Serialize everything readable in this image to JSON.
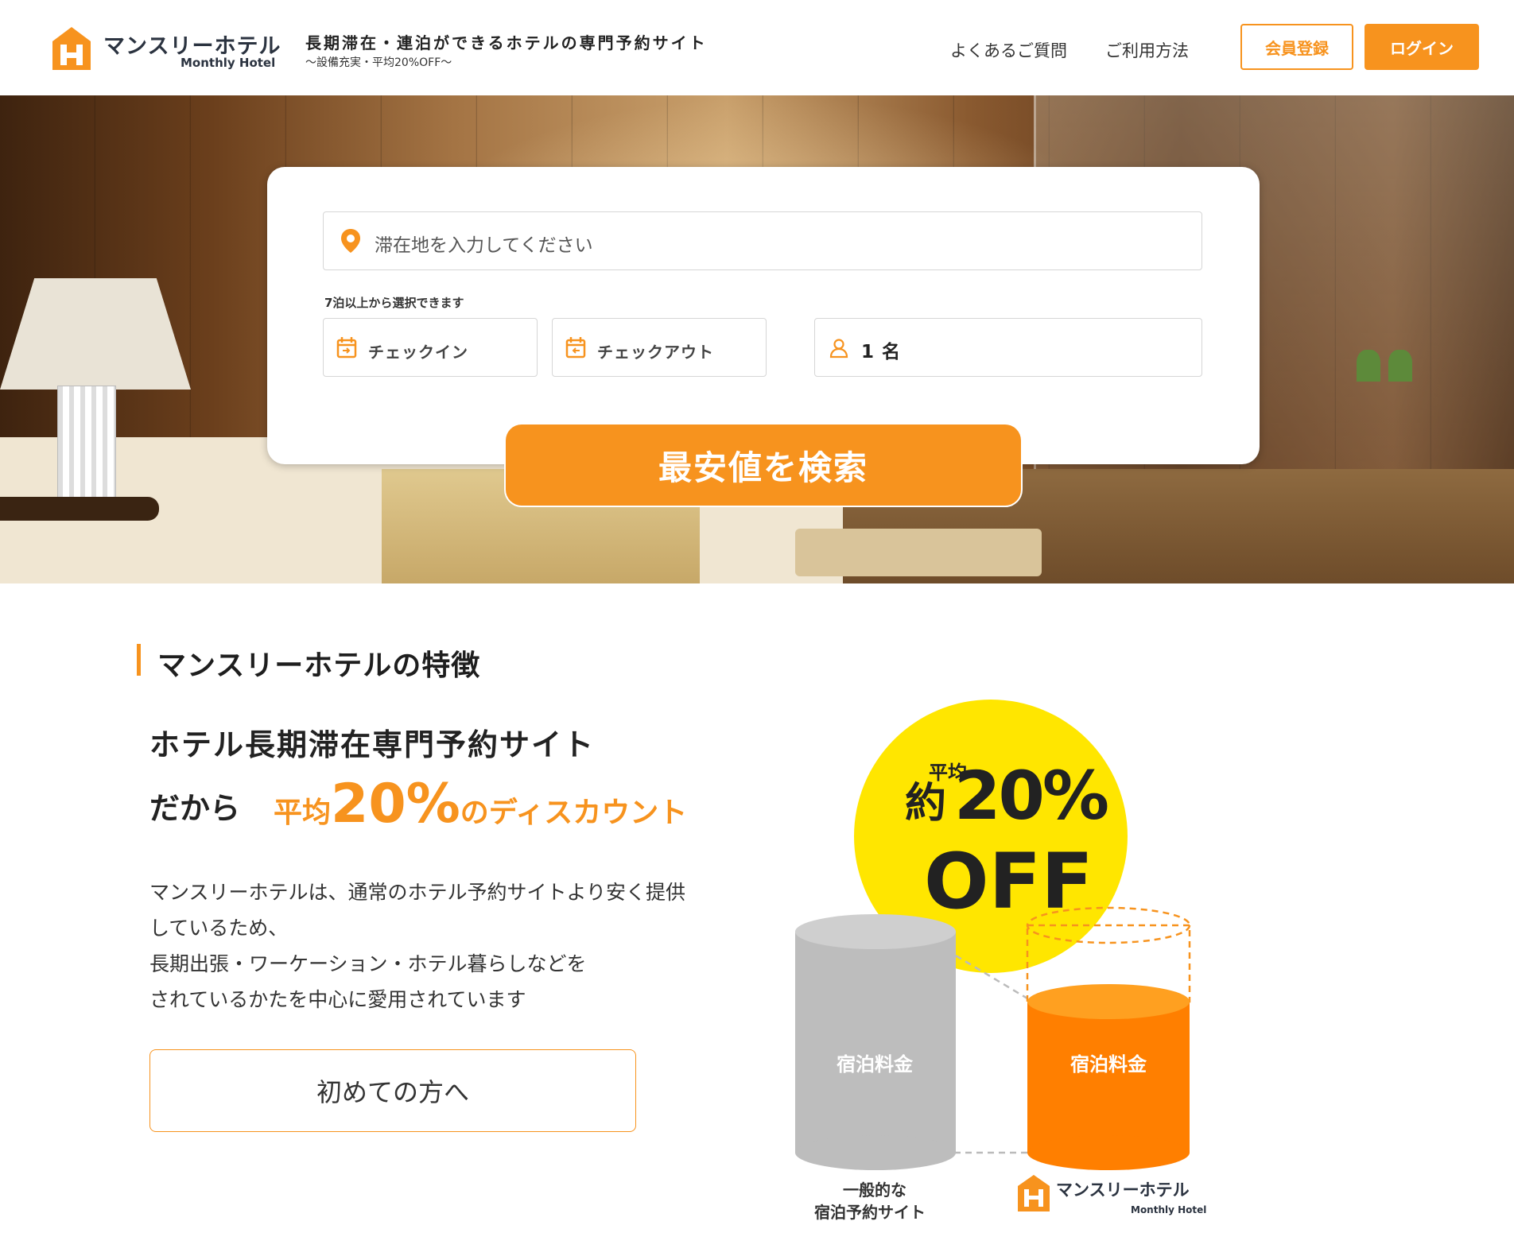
{
  "header": {
    "logo_jp": "マンスリーホテル",
    "logo_en": "Monthly Hotel",
    "tagline": "長期滞在・連泊ができるホテルの専門予約サイト",
    "subtagline": "〜設備充実・平均20%OFF〜",
    "nav": {
      "faq": "よくあるご質問",
      "howto": "ご利用方法"
    },
    "register_label": "会員登録",
    "login_label": "ログイン"
  },
  "search": {
    "location_placeholder": "滞在地を入力してください",
    "note": "7泊以上から選択できます",
    "checkin_label": "チェックイン",
    "checkout_label": "チェックアウト",
    "guests_label": "1 名",
    "submit_label": "最安値を検索"
  },
  "features": {
    "section_title": "マンスリーホテルの特徴",
    "headline_line1": "ホテル長期滞在専門予約サイト",
    "headline_line2_prefix": "だから",
    "headline_avg": "平均",
    "headline_percent": "20%",
    "headline_suffix": "のディスカウント",
    "body_lines": [
      "マンスリーホテルは、通常のホテル予約サイトより安く提供",
      "しているため、",
      "長期出張・ワーケーション・ホテル暮らしなどを",
      "されているかたを中心に愛用されています"
    ],
    "first_time_label": "初めての方へ"
  },
  "illustration": {
    "badge_avg": "平均",
    "badge_approx": "約",
    "badge_percent": "20%",
    "badge_off": "OFF",
    "gray_cylinder_label": "宿泊料金",
    "orange_cylinder_label": "宿泊料金",
    "caption_left_line1": "一般的な",
    "caption_left_line2": "宿泊予約サイト",
    "caption_right_jp": "マンスリーホテル",
    "caption_right_en": "Monthly Hotel"
  },
  "colors": {
    "accent": "#f7931e",
    "badge_yellow": "#ffe600",
    "cylinder_gray": "#bdbdbd",
    "text_dark": "#222222"
  }
}
